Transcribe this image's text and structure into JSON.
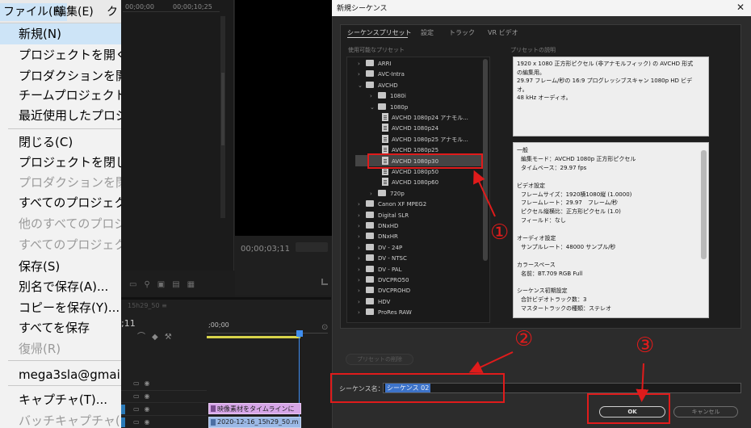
{
  "menubar": {
    "file": "ファイル(F)",
    "edit": "編集(E)",
    "clip": "ク"
  },
  "file_menu": {
    "items": [
      "新規(N)",
      "プロジェクトを開く(C",
      "プロダクションを開く",
      "チームプロジェクトを",
      "最近使用したプロジ",
      "閉じる(C)",
      "プロジェクトを閉じる",
      "プロダクションを閉じ",
      "すべてのプロジェクト",
      "他のすべてのプロジ",
      "すべてのプロジェクト",
      "保存(S)",
      "別名で保存(A)...",
      "コピーを保存(Y)...",
      "すべてを保存",
      "復帰(R)",
      "mega3sla@gmail",
      "キャプチャ(T)...",
      "バッチキャプチャ(B)..."
    ]
  },
  "premiere": {
    "tc_top_a": "00;00;00",
    "tc_top_b": "00;00;10;25",
    "monitor_timecode": "00;00;03;11",
    "seq_tab": "15h29_50 ≡",
    "timeline_tc": ";11",
    "ruler_tc": ";00;00",
    "clip_video": "映像素材をタイムラインに",
    "clip_audio": "2020-12-16_15h29_50.m"
  },
  "dialog": {
    "title": "新規シーケンス",
    "close_glyph": "✕",
    "tabs": [
      "シーケンスプリセット",
      "設定",
      "トラック",
      "VR ビデオ"
    ],
    "available_presets_label": "使用可能なプリセット",
    "description_label": "プリセットの説明",
    "tree": [
      {
        "label": "ARRI",
        "kind": "folder",
        "level": 0,
        "expanded": false
      },
      {
        "label": "AVC-Intra",
        "kind": "folder",
        "level": 0,
        "expanded": false
      },
      {
        "label": "AVCHD",
        "kind": "folder",
        "level": 0,
        "expanded": true
      },
      {
        "label": "1080i",
        "kind": "folder",
        "level": 1,
        "expanded": false
      },
      {
        "label": "1080p",
        "kind": "folder",
        "level": 1,
        "expanded": true
      },
      {
        "label": "AVCHD 1080p24 アナモル...",
        "kind": "file",
        "level": 2
      },
      {
        "label": "AVCHD 1080p24",
        "kind": "file",
        "level": 2
      },
      {
        "label": "AVCHD 1080p25 アナモル...",
        "kind": "file",
        "level": 2
      },
      {
        "label": "AVCHD 1080p25",
        "kind": "file",
        "level": 2
      },
      {
        "label": "AVCHD 1080p30",
        "kind": "file",
        "level": 2,
        "selected": true
      },
      {
        "label": "AVCHD 1080p50",
        "kind": "file",
        "level": 2
      },
      {
        "label": "AVCHD 1080p60",
        "kind": "file",
        "level": 2
      },
      {
        "label": "720p",
        "kind": "folder",
        "level": 1,
        "expanded": false
      },
      {
        "label": "Canon XF MPEG2",
        "kind": "folder",
        "level": 0,
        "expanded": false
      },
      {
        "label": "Digital SLR",
        "kind": "folder",
        "level": 0,
        "expanded": false
      },
      {
        "label": "DNxHD",
        "kind": "folder",
        "level": 0,
        "expanded": false
      },
      {
        "label": "DNxHR",
        "kind": "folder",
        "level": 0,
        "expanded": false
      },
      {
        "label": "DV - 24P",
        "kind": "folder",
        "level": 0,
        "expanded": false
      },
      {
        "label": "DV - NTSC",
        "kind": "folder",
        "level": 0,
        "expanded": false
      },
      {
        "label": "DV - PAL",
        "kind": "folder",
        "level": 0,
        "expanded": false
      },
      {
        "label": "DVCPRO50",
        "kind": "folder",
        "level": 0,
        "expanded": false
      },
      {
        "label": "DVCPROHD",
        "kind": "folder",
        "level": 0,
        "expanded": false
      },
      {
        "label": "HDV",
        "kind": "folder",
        "level": 0,
        "expanded": false
      },
      {
        "label": "ProRes RAW",
        "kind": "folder",
        "level": 0,
        "expanded": false
      }
    ],
    "description": [
      "1920 x 1080 正方形ピクセル (非アナモルフィック) の AVCHD 形式",
      "の編集用。",
      "29.97 フレーム/秒の 16:9 プログレッシブスキャン 1080p HD ビデ",
      "オ。",
      "48 kHz オーディオ。"
    ],
    "info": [
      {
        "text": "一般",
        "indent": 0
      },
      {
        "text": "編集モード：AVCHD 1080p 正方形ピクセル",
        "indent": 1
      },
      {
        "text": "タイムベース：29.97 fps",
        "indent": 1
      },
      {
        "text": "",
        "indent": 0
      },
      {
        "text": "ビデオ設定",
        "indent": 0
      },
      {
        "text": "フレームサイズ：1920横1080縦 (1.0000)",
        "indent": 1
      },
      {
        "text": "フレームレート：29.97　フレーム/秒",
        "indent": 1
      },
      {
        "text": "ピクセル縦横比：正方形ピクセル (1.0)",
        "indent": 1
      },
      {
        "text": "フィールド：なし",
        "indent": 1
      },
      {
        "text": "",
        "indent": 0
      },
      {
        "text": "オーディオ設定",
        "indent": 0
      },
      {
        "text": "サンプルレート：48000 サンプル/秒",
        "indent": 1
      },
      {
        "text": "",
        "indent": 0
      },
      {
        "text": "カラースペース",
        "indent": 0
      },
      {
        "text": "名前：BT.709 RGB Full",
        "indent": 1
      },
      {
        "text": "",
        "indent": 0
      },
      {
        "text": "シーケンス初期設定",
        "indent": 0
      },
      {
        "text": "合計ビデオトラック数：3",
        "indent": 1
      },
      {
        "text": "マスタートラックの種類：ステレオ",
        "indent": 1
      }
    ],
    "delete_preset_button": "プリセットの削除",
    "sequence_name_label": "シーケンス名：",
    "sequence_name_value": "シーケンス 02",
    "ok_button": "OK",
    "cancel_button": "キャンセル"
  },
  "annotations": {
    "marker_1": "①",
    "marker_2": "②",
    "marker_3": "③",
    "color": "#e01b1b"
  }
}
